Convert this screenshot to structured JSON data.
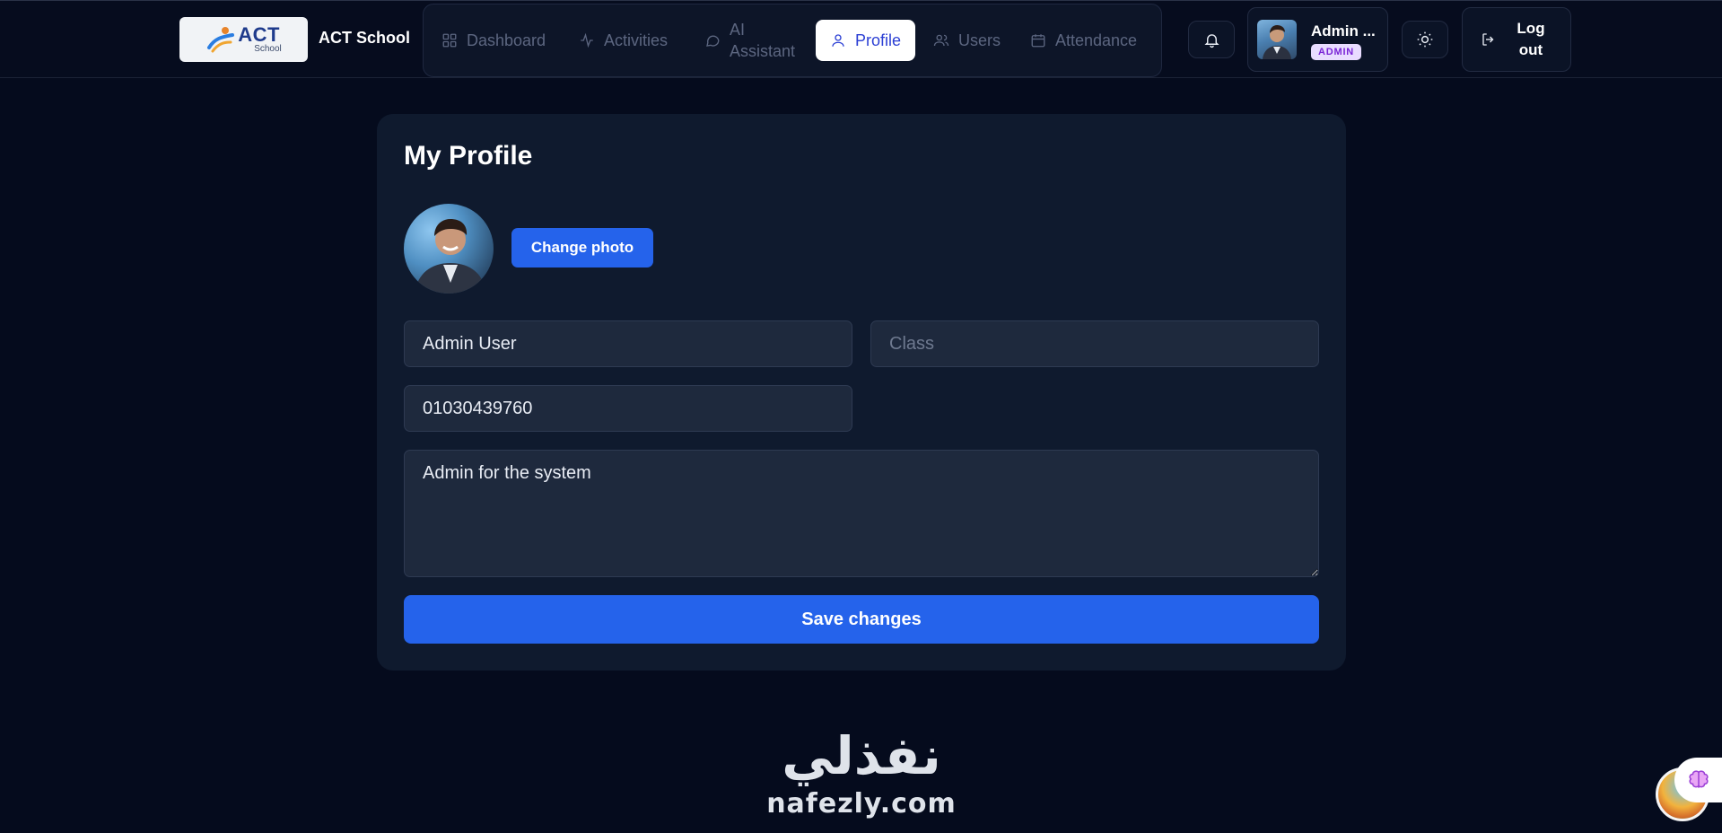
{
  "header": {
    "logo": {
      "big": "ACT",
      "small": "School"
    },
    "brand_name": "ACT School",
    "nav": [
      {
        "label": "Dashboard",
        "icon": "grid-icon"
      },
      {
        "label": "Activities",
        "icon": "activity-icon"
      },
      {
        "label_line1": "AI",
        "label_line2": "Assistant",
        "icon": "message-icon"
      },
      {
        "label": "Profile",
        "icon": "user-icon",
        "active": true
      },
      {
        "label": "Users",
        "icon": "users-icon"
      },
      {
        "label": "Attendance",
        "icon": "calendar-icon"
      }
    ],
    "user": {
      "name": "Admin ...",
      "role": "ADMIN"
    },
    "logout": {
      "line1": "Log",
      "line2": "out"
    }
  },
  "profile": {
    "title": "My Profile",
    "change_photo_label": "Change photo",
    "name_value": "Admin User",
    "class_placeholder": "Class",
    "phone_value": "01030439760",
    "bio_value": "Admin for the system",
    "save_label": "Save changes"
  },
  "footer": {
    "arabic": "نفذلي",
    "latin": "nafezly.com"
  },
  "colors": {
    "background": "#050b1d",
    "card": "#0f1a2e",
    "primary": "#2563eb",
    "active_nav_text": "#2b3fd4",
    "badge_bg": "#e9dcff",
    "badge_text": "#7a25d6"
  }
}
